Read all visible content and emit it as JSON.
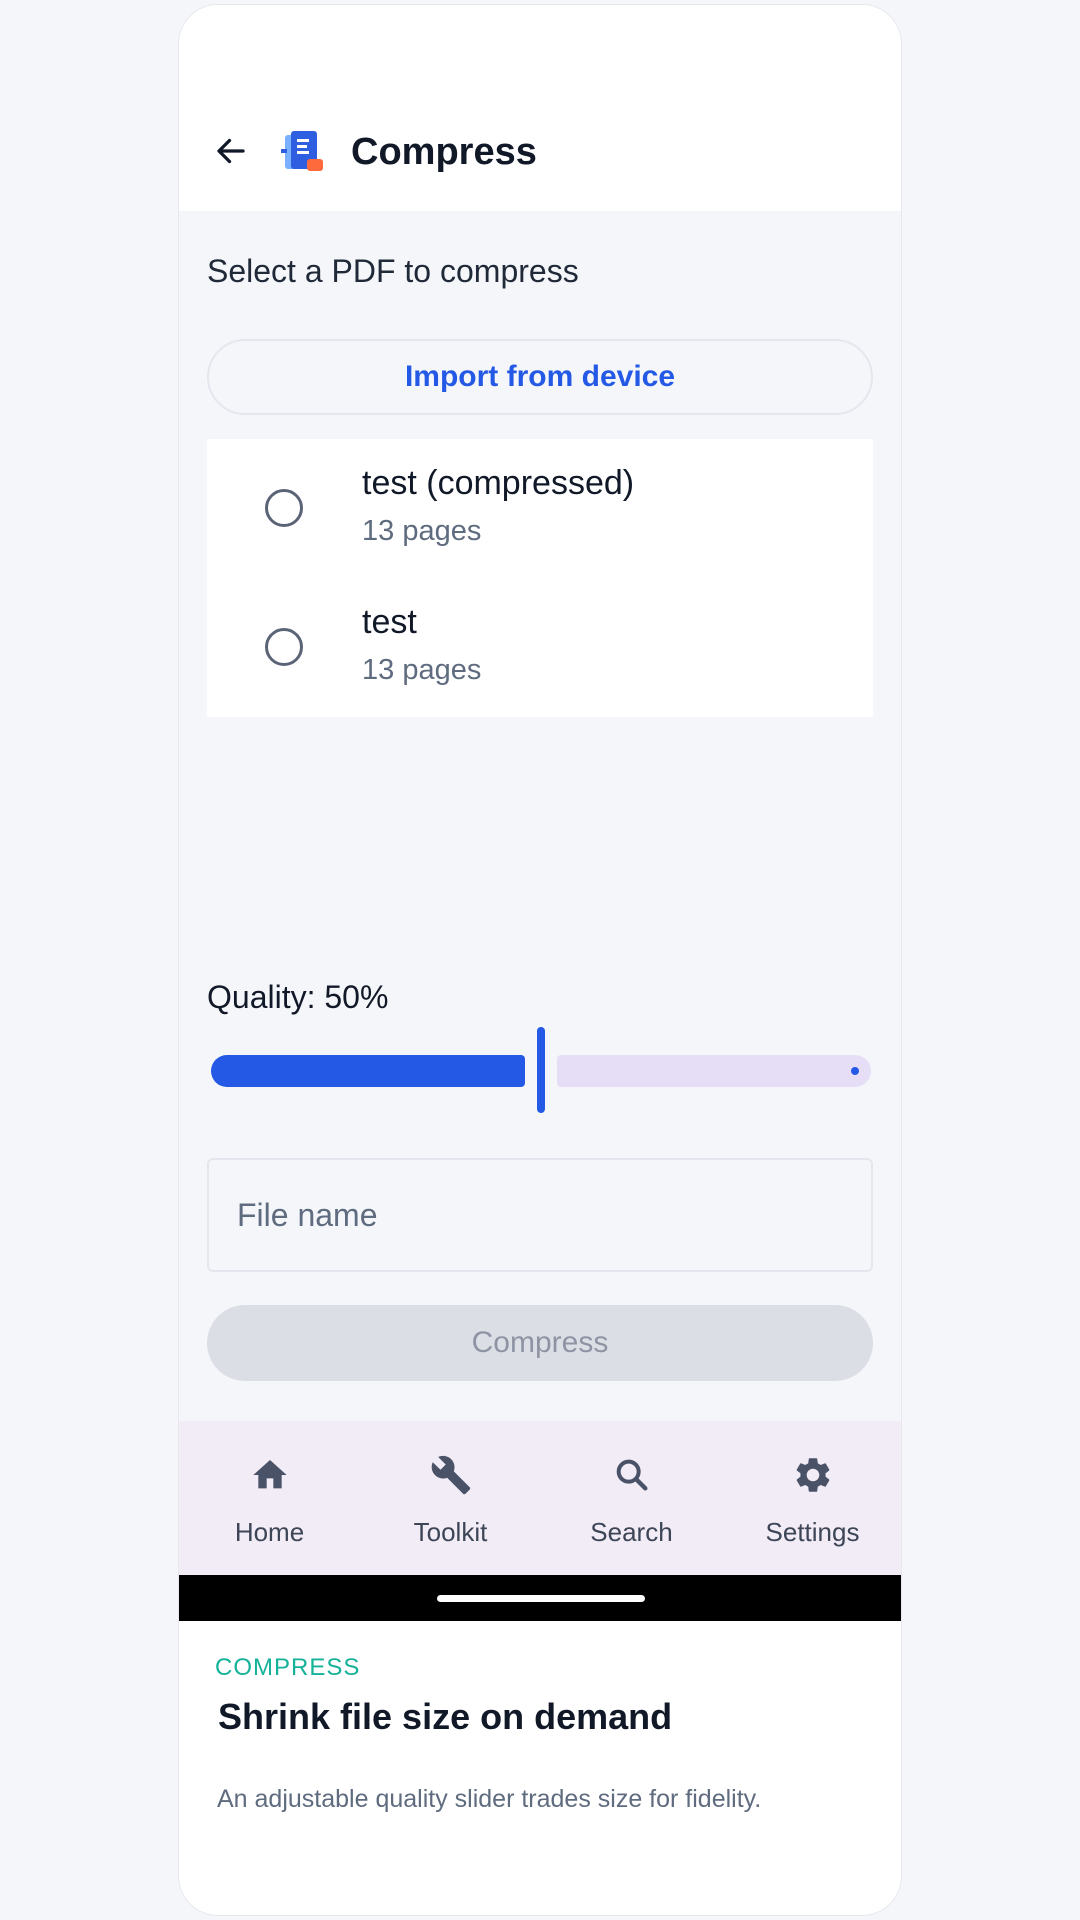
{
  "app_bar": {
    "title": "Compress",
    "back_icon": "arrow-left-icon",
    "logo_icon": "pdf-app-logo-icon"
  },
  "main": {
    "instruction": "Select a PDF to compress",
    "import_button_label": "Import from device",
    "files": [
      {
        "name": "test (compressed)",
        "pages": "13 pages",
        "selected": false
      },
      {
        "name": "test",
        "pages": "13 pages",
        "selected": false
      }
    ],
    "quality_label": "Quality: 50%",
    "quality_value": 0.5,
    "file_name_placeholder": "File name",
    "file_name_value": "",
    "compress_button_label": "Compress",
    "compress_button_enabled": false
  },
  "bottom_nav": {
    "items": [
      {
        "label": "Home",
        "icon": "home-icon"
      },
      {
        "label": "Toolkit",
        "icon": "wrench-icon"
      },
      {
        "label": "Search",
        "icon": "search-icon"
      },
      {
        "label": "Settings",
        "icon": "gear-icon"
      }
    ]
  },
  "promo": {
    "kicker": "COMPRESS",
    "title": "Shrink file size on demand",
    "description": "An adjustable quality slider trades size for fidelity."
  },
  "colors": {
    "accent": "#2459e6",
    "slider_track_inactive": "#e6def7",
    "nav_background": "#f1ecf6",
    "promo_kicker": "#15b29a",
    "button_disabled_bg": "#dcdee5"
  }
}
